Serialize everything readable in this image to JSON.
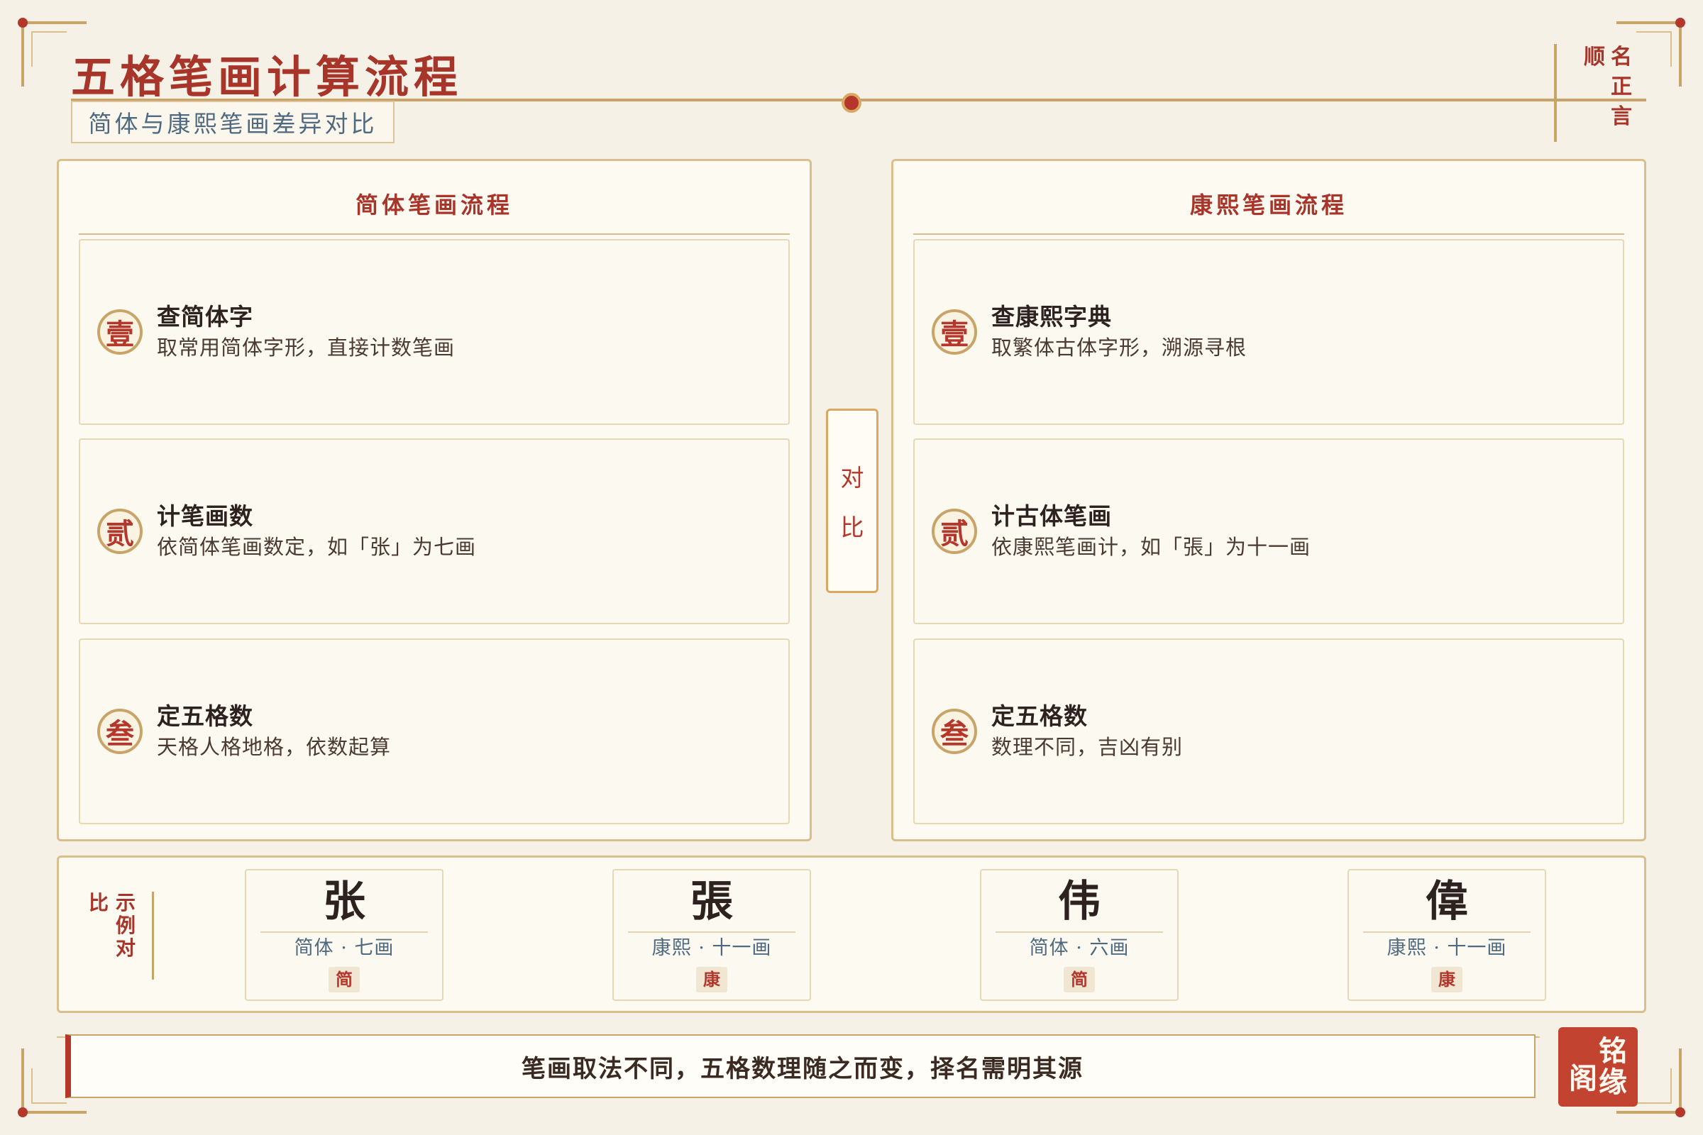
{
  "header": {
    "title": "五格笔画计算流程",
    "subtitle": "简体与康熙笔画差异对比",
    "seal_text": [
      "名",
      "正",
      "言",
      "顺"
    ]
  },
  "left_panel": {
    "title": "简体笔画流程",
    "steps": [
      {
        "badge": "壹",
        "head": "查简体字",
        "desc": "取常用简体字形，直接计数笔画"
      },
      {
        "badge": "贰",
        "head": "计笔画数",
        "desc": "依简体笔画数定，如「张」为七画"
      },
      {
        "badge": "叁",
        "head": "定五格数",
        "desc": "天格人格地格，依数起算"
      }
    ]
  },
  "compare_tag": [
    "对",
    "比"
  ],
  "right_panel": {
    "title": "康熙笔画流程",
    "steps": [
      {
        "badge": "壹",
        "head": "查康熙字典",
        "desc": "取繁体古体字形，溯源寻根"
      },
      {
        "badge": "贰",
        "head": "计古体笔画",
        "desc": "依康熙笔画计，如「張」为十一画"
      },
      {
        "badge": "叁",
        "head": "定五格数",
        "desc": "数理不同，吉凶有别"
      }
    ]
  },
  "examples": {
    "label": [
      "示",
      "例",
      "对",
      "比"
    ],
    "cards": [
      {
        "char": "张",
        "sub": "简体 · 七画",
        "tag": "简"
      },
      {
        "char": "張",
        "sub": "康熙 · 十一画",
        "tag": "康"
      },
      {
        "char": "伟",
        "sub": "简体 · 六画",
        "tag": "简"
      },
      {
        "char": "偉",
        "sub": "康熙 · 十一画",
        "tag": "康"
      }
    ]
  },
  "footer": {
    "text": "笔画取法不同，五格数理随之而变，择名需明其源"
  },
  "brand_seal": [
    "铭",
    "缘",
    "阁"
  ],
  "colors": {
    "accent_red": "#a7352a",
    "seal_red": "#c2432f",
    "gold": "#c9a468",
    "background": "#f6f1e7",
    "subtitle_blue": "#4f6a80"
  }
}
